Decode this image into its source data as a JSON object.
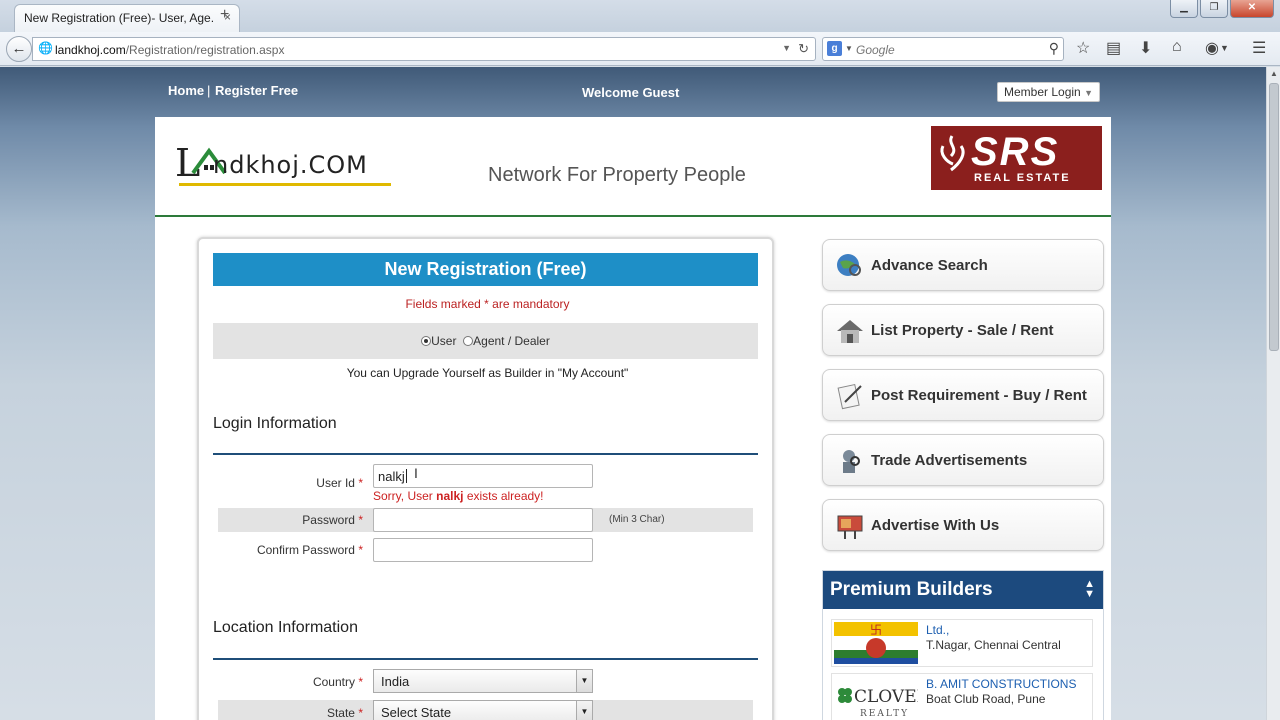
{
  "browser": {
    "tab_title": "New Registration (Free)- User, Age...",
    "tab_close": "×",
    "new_tab": "+",
    "url_domain": "landkhoj.com",
    "url_path": "/Registration/registration.aspx",
    "search_engine_letter": "g",
    "search_placeholder": "Google",
    "window_minimize": "▁",
    "window_restore": "❐",
    "window_close": "✕"
  },
  "topnav": {
    "home": "Home",
    "separator": "|",
    "register": "Register Free",
    "welcome": "Welcome Guest",
    "member_login": "Member Login"
  },
  "header": {
    "logo_text": "ndkhoj.COM",
    "logo_letter": "L",
    "tagline": "Network For Property People",
    "ad_name": "SRS",
    "ad_sub": "REAL ESTATE"
  },
  "registration": {
    "title": "New Registration (Free)",
    "mandatory_note": "Fields marked * are mandatory",
    "user_types": [
      "User",
      "Agent / Dealer"
    ],
    "upgrade_note": "You can Upgrade Yourself as Builder in \"My Account\"",
    "login_section": "Login Information",
    "userid_label": "User Id",
    "userid_value": "nalkj",
    "error_prefix": "Sorry, User ",
    "error_user": "nalkj",
    "error_suffix": " exists already!",
    "password_label": "Password",
    "password_hint": "(Min 3 Char)",
    "confirm_label": "Confirm Password",
    "location_section": "Location Information",
    "country_label": "Country",
    "country_value": "India",
    "state_label": "State",
    "state_value": "Select State",
    "required_mark": "*"
  },
  "sidebar": {
    "buttons": [
      "Advance Search",
      "List Property - Sale / Rent",
      "Post Requirement - Buy / Rent",
      "Trade Advertisements",
      "Advertise With Us"
    ],
    "premium_title": "Premium Builders",
    "builders": [
      {
        "name": "Ltd.,",
        "address": "T.Nagar, Chennai Central"
      },
      {
        "name": "B. AMIT CONSTRUCTIONS",
        "address": "Boat Club Road, Pune"
      }
    ],
    "clover_logo": "CLOVER",
    "clover_sub": "REALTY"
  }
}
